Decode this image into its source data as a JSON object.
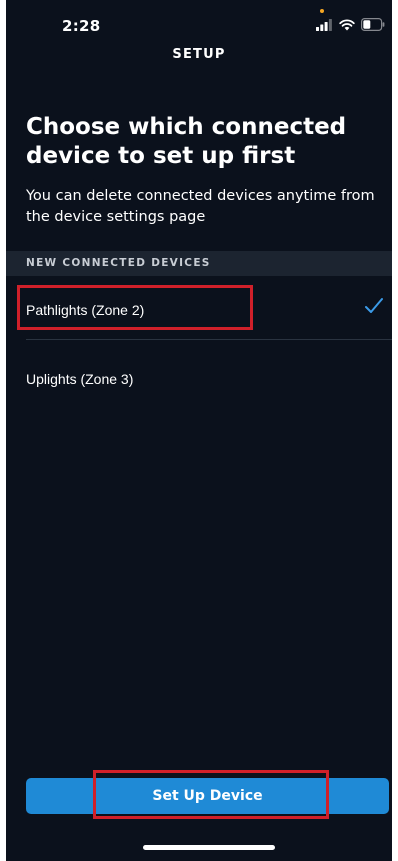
{
  "status_bar": {
    "time": "2:28",
    "icons": [
      "signal-icon",
      "wifi-icon",
      "battery-icon"
    ],
    "privacy_dot_color": "#f5a623"
  },
  "header": {
    "title": "SETUP"
  },
  "main": {
    "heading": "Choose which connected device to set up first",
    "subtext": "You can delete connected devices anytime from the device settings page",
    "section_header": "NEW CONNECTED DEVICES",
    "devices": [
      {
        "label": "Pathlights (Zone 2)",
        "selected": true
      },
      {
        "label": "Uplights (Zone 3)",
        "selected": false
      }
    ],
    "selected_icon": "checkmark-icon"
  },
  "footer": {
    "primary_button_label": "Set Up Device"
  },
  "colors": {
    "background": "#0b111c",
    "section_header_bg": "#1c2430",
    "accent": "#1f8ad6",
    "checkmark": "#3b9be8",
    "highlight": "#d0202a"
  }
}
